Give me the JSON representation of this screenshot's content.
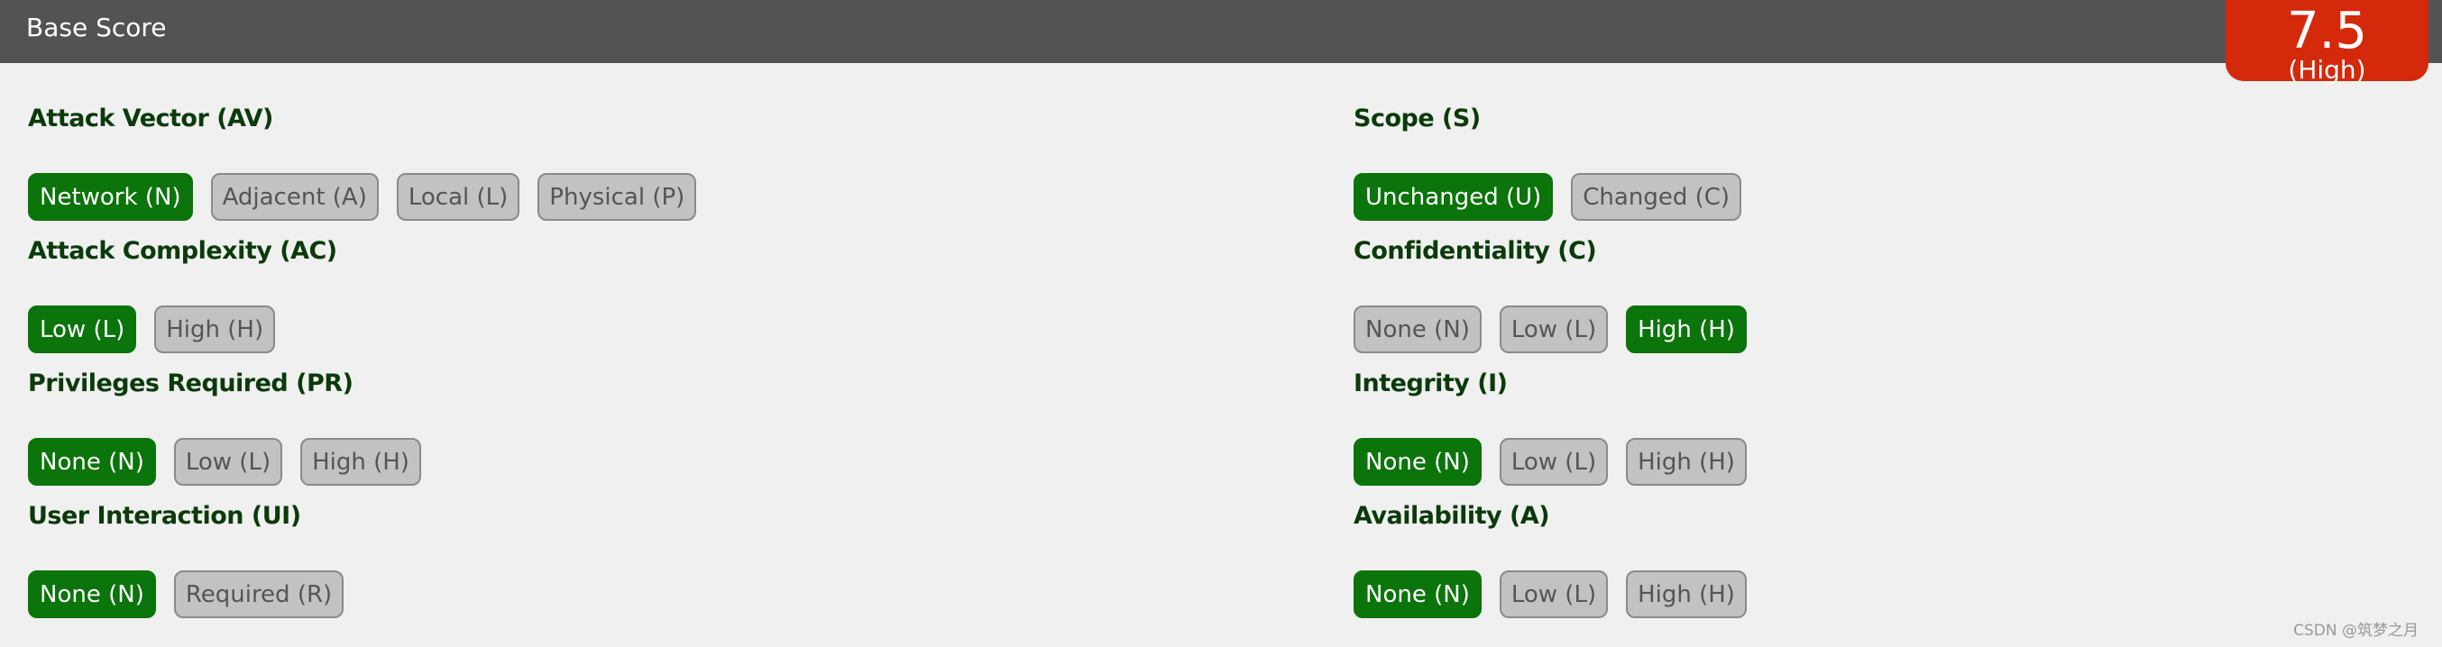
{
  "header": {
    "title": "Base Score"
  },
  "score": {
    "value": "7.5",
    "severity": "(High)",
    "color": "#d4290a"
  },
  "colors": {
    "selected": "#0b740b",
    "unselected": "#c2c2c2",
    "label": "#0b3a0b"
  },
  "left": [
    {
      "label": "Attack Vector (AV)",
      "options": [
        "Network (N)",
        "Adjacent (A)",
        "Local (L)",
        "Physical (P)"
      ],
      "selected": 0
    },
    {
      "label": "Attack Complexity (AC)",
      "options": [
        "Low (L)",
        "High (H)"
      ],
      "selected": 0
    },
    {
      "label": "Privileges Required (PR)",
      "options": [
        "None (N)",
        "Low (L)",
        "High (H)"
      ],
      "selected": 0
    },
    {
      "label": "User Interaction (UI)",
      "options": [
        "None (N)",
        "Required (R)"
      ],
      "selected": 0
    }
  ],
  "right": [
    {
      "label": "Scope (S)",
      "options": [
        "Unchanged (U)",
        "Changed (C)"
      ],
      "selected": 0
    },
    {
      "label": "Confidentiality (C)",
      "options": [
        "None (N)",
        "Low (L)",
        "High (H)"
      ],
      "selected": 2
    },
    {
      "label": "Integrity (I)",
      "options": [
        "None (N)",
        "Low (L)",
        "High (H)"
      ],
      "selected": 0
    },
    {
      "label": "Availability (A)",
      "options": [
        "None (N)",
        "Low (L)",
        "High (H)"
      ],
      "selected": 0
    }
  ],
  "watermark": "CSDN @筑梦之月"
}
